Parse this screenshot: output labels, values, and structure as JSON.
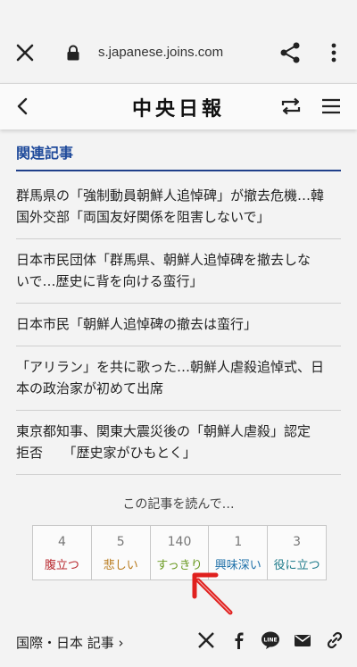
{
  "browser": {
    "url": "s.japanese.joins.com"
  },
  "header": {
    "logo": "中央日報"
  },
  "related": {
    "title": "関連記事",
    "items": [
      {
        "line1": "群馬県の「強制動員朝鮮人追悼碑」が撤去危機…韓",
        "line2": "国外交部「両国友好関係を阻害しないで」"
      },
      {
        "line1": "日本市民団体「群馬県、朝鮮人追悼碑を撤去しな",
        "line2": "いで…歴史に背を向ける蛮行」"
      },
      {
        "line1": "日本市民「朝鮮人追悼碑の撤去は蛮行」",
        "line2": ""
      },
      {
        "line1": "「アリラン」を共に歌った…朝鮮人虐殺追悼式、日",
        "line2": "本の政治家が初めて出席"
      },
      {
        "line1": "東京都知事、関東大震災後の「朝鮮人虐殺」認定",
        "line2": "拒否　　「歴史家がひもとく」"
      }
    ]
  },
  "reactions": {
    "prompt": "この記事を読んで…",
    "items": [
      {
        "count": "4",
        "label": "腹立つ",
        "color": "#b8292f"
      },
      {
        "count": "5",
        "label": "悲しい",
        "color": "#b87a1c"
      },
      {
        "count": "140",
        "label": "すっきり",
        "color": "#6a9a22"
      },
      {
        "count": "1",
        "label": "興味深い",
        "color": "#1d6fa8"
      },
      {
        "count": "3",
        "label": "役に立つ",
        "color": "#1d7a8a"
      }
    ]
  },
  "footer": {
    "category": "国際・日本 記事 ›"
  },
  "colors": {
    "accent": "#1f4a9b",
    "arrow": "#e0201e"
  }
}
